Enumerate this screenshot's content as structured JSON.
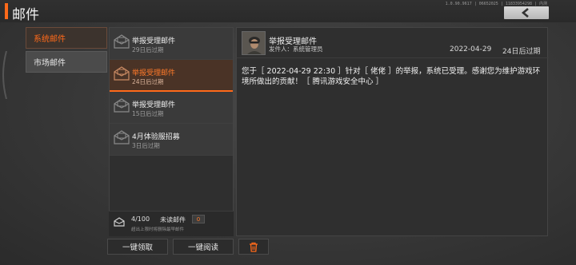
{
  "header": {
    "title": "邮件",
    "version": "1.0.90.9617 | 06652025 | 11833954298 | 内测"
  },
  "tabs": [
    {
      "label": "系统邮件",
      "active": true
    },
    {
      "label": "市场邮件",
      "active": false
    }
  ],
  "mails": [
    {
      "title": "举报受理邮件",
      "expire": "29日后过期",
      "selected": false
    },
    {
      "title": "举报受理邮件",
      "expire": "24日后过期",
      "selected": true
    },
    {
      "title": "举报受理邮件",
      "expire": "15日后过期",
      "selected": false
    },
    {
      "title": "4月体验服招募",
      "expire": "3日后过期",
      "selected": false
    }
  ],
  "footer": {
    "count": "4/100",
    "unread_label": "未读邮件",
    "unread_count": "0",
    "note": "超出上限时将删除最早邮件"
  },
  "detail": {
    "title": "举报受理邮件",
    "sender": "发件人：系统管理员",
    "date": "2022-04-29",
    "expire": "24日后过期",
    "body": "您于［ 2022-04-29 22:30 ］针对［ 佬佬 ］的举报，系统已受理。感谢您为维护游戏环境所做出的贡献！［ 腾讯游戏安全中心 ］"
  },
  "buttons": {
    "claim_all": "一键领取",
    "read_all": "一键阅读"
  },
  "colors": {
    "accent": "#ff6a1a"
  }
}
